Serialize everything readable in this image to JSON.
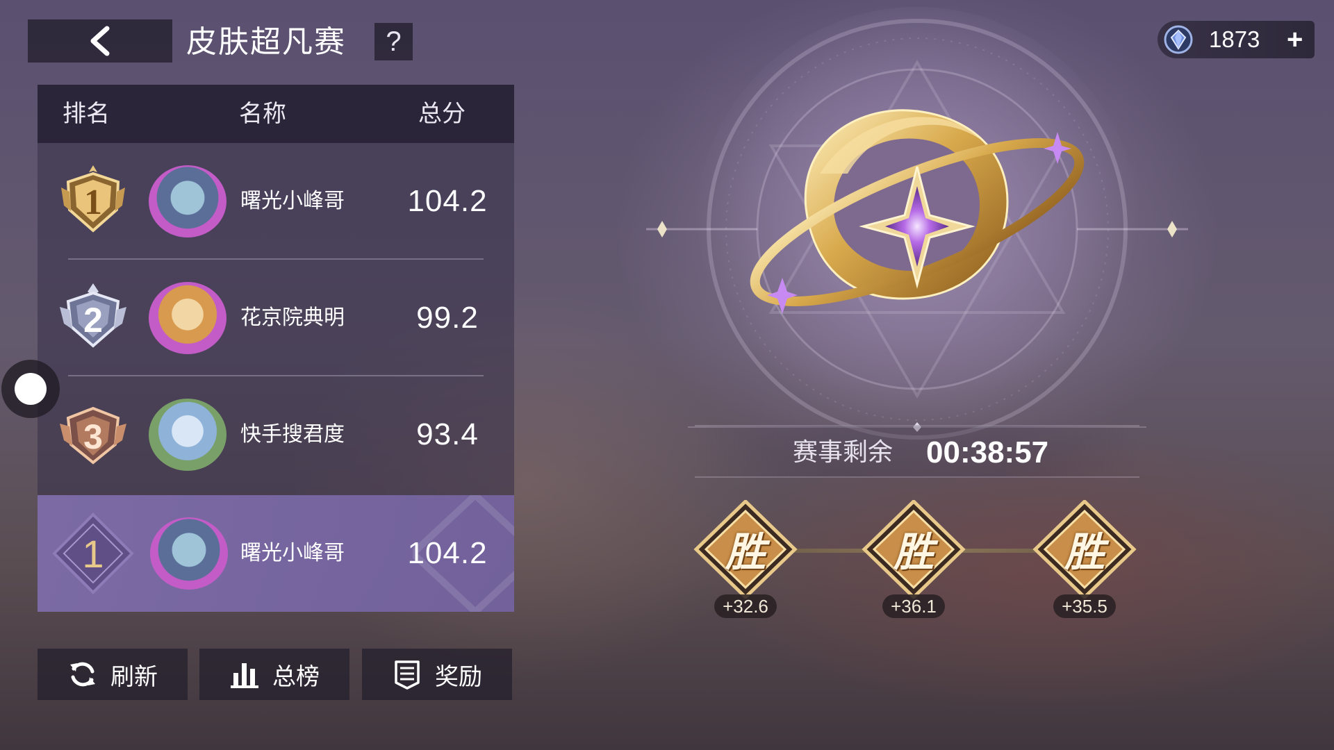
{
  "header": {
    "title": "皮肤超凡赛",
    "help_label": "?",
    "currency_amount": "1873",
    "currency_add": "+"
  },
  "ranking": {
    "columns": {
      "rank": "排名",
      "name": "名称",
      "score": "总分"
    },
    "rows": [
      {
        "rank": "1",
        "name": "曙光小峰哥",
        "score": "104.2",
        "medal": "gold"
      },
      {
        "rank": "2",
        "name": "花京院典明",
        "score": "99.2",
        "medal": "silver"
      },
      {
        "rank": "3",
        "name": "快手搜君度",
        "score": "93.4",
        "medal": "bronze"
      }
    ],
    "me": {
      "rank": "1",
      "name": "曙光小峰哥",
      "score": "104.2"
    }
  },
  "buttons": {
    "refresh": "刷新",
    "leaderboard": "总榜",
    "rewards": "奖励"
  },
  "event": {
    "remaining_label": "赛事剩余",
    "remaining_time": "00:38:57",
    "results": [
      {
        "label": "胜",
        "points": "+32.6"
      },
      {
        "label": "胜",
        "points": "+36.1"
      },
      {
        "label": "胜",
        "points": "+35.5"
      }
    ]
  },
  "colors": {
    "gold": "#d9b46a",
    "silver": "#c9cde0",
    "bronze": "#d8a07a",
    "highlight_row": "#7d6ca8"
  }
}
